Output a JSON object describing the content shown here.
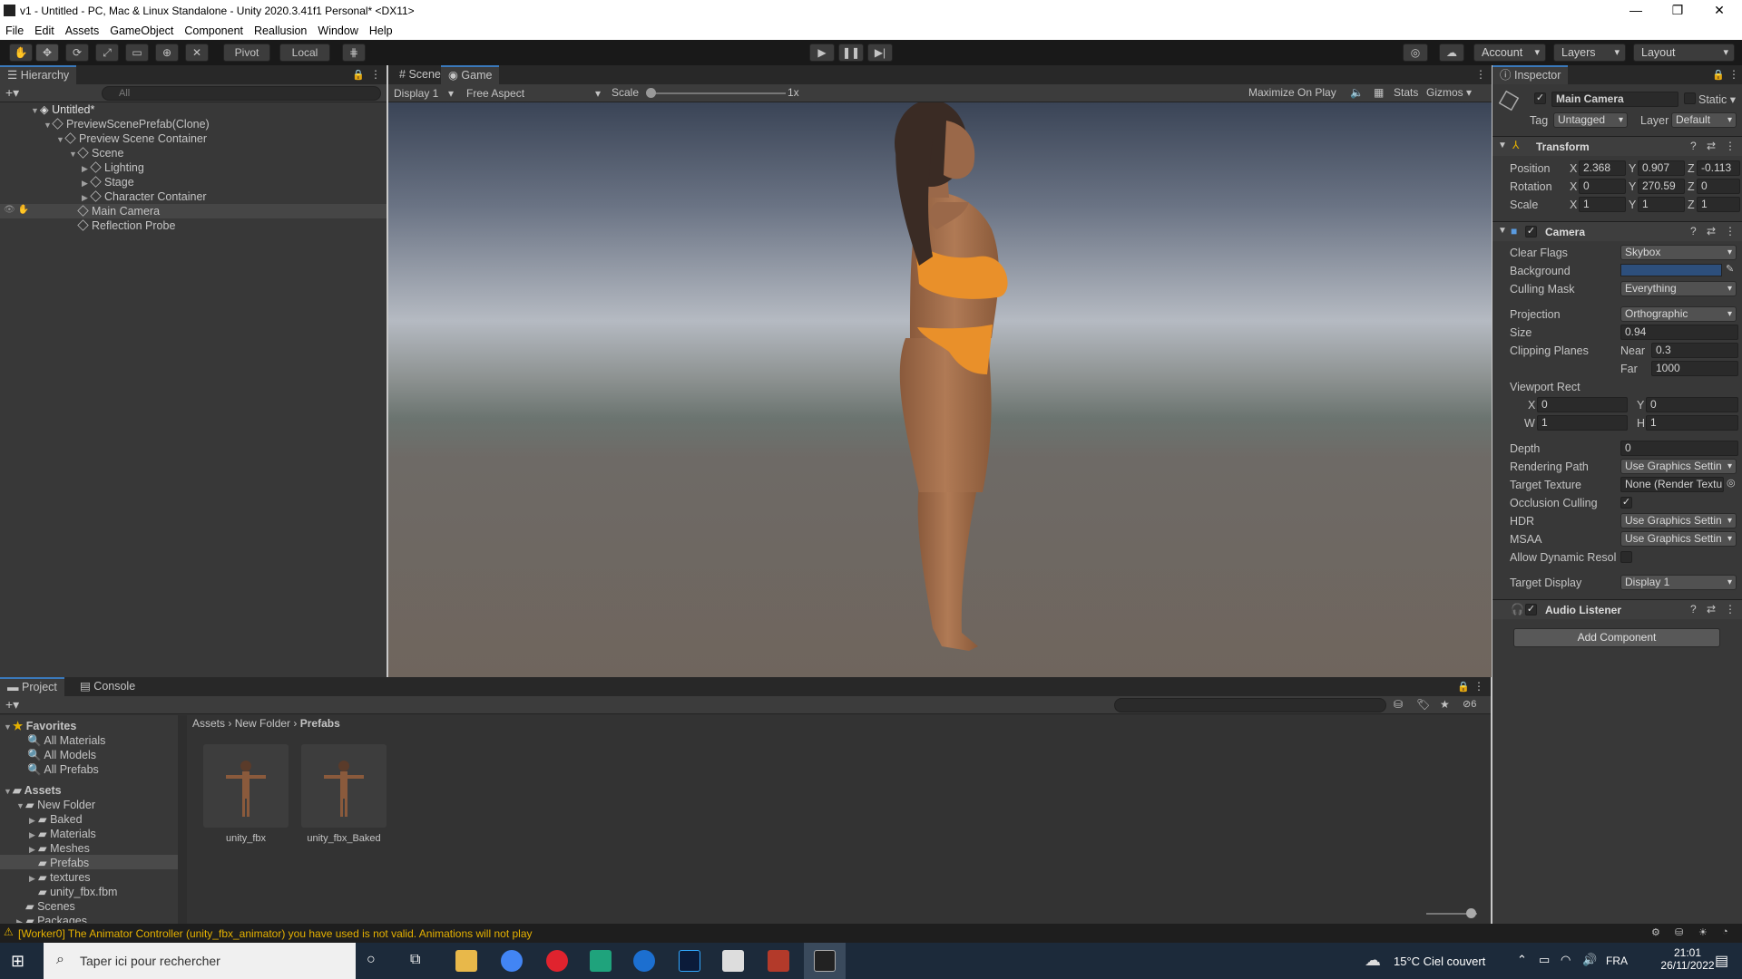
{
  "window": {
    "title": "v1 - Untitled - PC, Mac & Linux Standalone - Unity 2020.3.41f1 Personal* <DX11>",
    "minimize": "—",
    "maximize": "❐",
    "close": "✕"
  },
  "menu": [
    "File",
    "Edit",
    "Assets",
    "GameObject",
    "Component",
    "Reallusion",
    "Window",
    "Help"
  ],
  "toolbar": {
    "pivot": "Pivot",
    "local": "Local",
    "account": "Account",
    "layers": "Layers",
    "layout": "Layout"
  },
  "hierarchy": {
    "tab": "Hierarchy",
    "search_placeholder": "All",
    "items": [
      {
        "label": "Untitled*"
      },
      {
        "label": "PreviewScenePrefab(Clone)"
      },
      {
        "label": "Preview Scene Container"
      },
      {
        "label": "Scene"
      },
      {
        "label": "Lighting"
      },
      {
        "label": "Stage"
      },
      {
        "label": "Character Container"
      },
      {
        "label": "Main Camera"
      },
      {
        "label": "Reflection Probe"
      }
    ]
  },
  "scene_tabs": {
    "scene": "Scene",
    "game": "Game"
  },
  "game_bar": {
    "display": "Display 1",
    "aspect": "Free Aspect",
    "scale_label": "Scale",
    "scale_value": "1x",
    "maximize": "Maximize On Play",
    "stats": "Stats",
    "gizmos": "Gizmos"
  },
  "inspector": {
    "tab": "Inspector",
    "object_name": "Main Camera",
    "static": "Static",
    "tag_label": "Tag",
    "tag": "Untagged",
    "layer_label": "Layer",
    "layer": "Default",
    "transform": {
      "title": "Transform",
      "position_label": "Position",
      "pos_x": "2.368",
      "pos_y": "0.907",
      "pos_z": "-0.113",
      "rotation_label": "Rotation",
      "rot_x": "0",
      "rot_y": "270.59",
      "rot_z": "0",
      "scale_label": "Scale",
      "scl_x": "1",
      "scl_y": "1",
      "scl_z": "1",
      "x": "X",
      "y": "Y",
      "z": "Z"
    },
    "camera": {
      "title": "Camera",
      "clear_flags_label": "Clear Flags",
      "clear_flags": "Skybox",
      "background_label": "Background",
      "background_color": "#2d4f7c",
      "culling_mask_label": "Culling Mask",
      "culling_mask": "Everything",
      "projection_label": "Projection",
      "projection": "Orthographic",
      "size_label": "Size",
      "size": "0.94",
      "clipping_label": "Clipping Planes",
      "near_label": "Near",
      "near": "0.3",
      "far_label": "Far",
      "far": "1000",
      "viewport_label": "Viewport Rect",
      "vx_label": "X",
      "vx": "0",
      "vy_label": "Y",
      "vy": "0",
      "vw_label": "W",
      "vw": "1",
      "vh_label": "H",
      "vh": "1",
      "depth_label": "Depth",
      "depth": "0",
      "rendering_path_label": "Rendering Path",
      "rendering_path": "Use Graphics Settin",
      "target_texture_label": "Target Texture",
      "target_texture": "None (Render Textu",
      "occlusion_label": "Occlusion Culling",
      "hdr_label": "HDR",
      "hdr": "Use Graphics Settin",
      "msaa_label": "MSAA",
      "msaa": "Use Graphics Settin",
      "dynamic_res_label": "Allow Dynamic Resol",
      "target_display_label": "Target Display",
      "target_display": "Display 1"
    },
    "audio_listener": {
      "title": "Audio Listener"
    },
    "add_component": "Add Component"
  },
  "project": {
    "tab_project": "Project",
    "tab_console": "Console",
    "favorites": "Favorites",
    "favorites_items": [
      "All Materials",
      "All Models",
      "All Prefabs"
    ],
    "assets": "Assets",
    "tree": [
      {
        "label": "New Folder"
      },
      {
        "label": "Baked"
      },
      {
        "label": "Materials"
      },
      {
        "label": "Meshes"
      },
      {
        "label": "Prefabs"
      },
      {
        "label": "textures"
      },
      {
        "label": "unity_fbx.fbm"
      },
      {
        "label": "Scenes"
      },
      {
        "label": "Packages"
      }
    ],
    "breadcrumb": [
      "Assets",
      "New Folder",
      "Prefabs"
    ],
    "hidden_count": "6",
    "assets_grid": [
      {
        "label": "unity_fbx"
      },
      {
        "label": "unity_fbx_Baked"
      }
    ]
  },
  "status": {
    "message": "[Worker0] The Animator Controller (unity_fbx_animator) you have used is not valid. Animations will not play"
  },
  "taskbar": {
    "search_placeholder": "Taper ici pour rechercher",
    "weather": "15°C  Ciel couvert",
    "lang": "FRA",
    "time": "21:01",
    "date": "26/11/2022"
  }
}
